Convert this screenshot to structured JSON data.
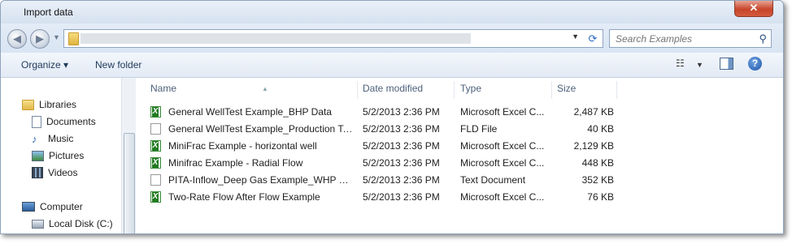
{
  "window": {
    "title": "Import data",
    "close_label": "✕"
  },
  "address": {
    "search_placeholder": "Search Examples"
  },
  "toolbar": {
    "organize": "Organize ▾",
    "new_folder": "New folder"
  },
  "nav": {
    "libraries": "Libraries",
    "documents": "Documents",
    "music": "Music",
    "pictures": "Pictures",
    "videos": "Videos",
    "computer": "Computer",
    "local_disk": "Local Disk (C:)"
  },
  "columns": {
    "name": "Name",
    "date": "Date modified",
    "type": "Type",
    "size": "Size"
  },
  "files": [
    {
      "name": "General WellTest Example_BHP Data",
      "date": "5/2/2013 2:36 PM",
      "type": "Microsoft Excel C...",
      "size": "2,487 KB",
      "icon": "excel-icon"
    },
    {
      "name": "General WellTest Example_Production Te...",
      "date": "5/2/2013 2:36 PM",
      "type": "FLD File",
      "size": "40 KB",
      "icon": "file-icon"
    },
    {
      "name": "MiniFrac Example - horizontal well",
      "date": "5/2/2013 2:36 PM",
      "type": "Microsoft Excel C...",
      "size": "2,129 KB",
      "icon": "excel-icon"
    },
    {
      "name": "Minifrac Example - Radial Flow",
      "date": "5/2/2013 2:36 PM",
      "type": "Microsoft Excel C...",
      "size": "448 KB",
      "icon": "excel-icon"
    },
    {
      "name": "PITA-Inflow_Deep Gas Example_WHP Data",
      "date": "5/2/2013 2:36 PM",
      "type": "Text Document",
      "size": "352 KB",
      "icon": "text-file-icon"
    },
    {
      "name": "Two-Rate Flow After Flow Example",
      "date": "5/2/2013 2:36 PM",
      "type": "Microsoft Excel C...",
      "size": "76 KB",
      "icon": "excel-icon"
    }
  ]
}
